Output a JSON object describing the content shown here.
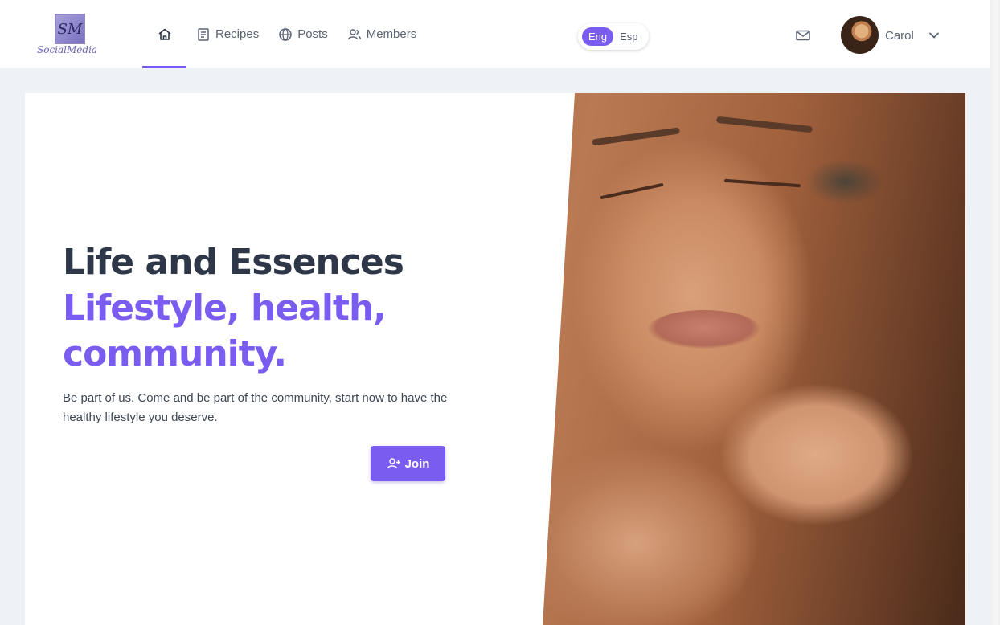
{
  "brand": {
    "logo_monogram": "SM",
    "wordmark": "SocialMedia"
  },
  "nav": {
    "items": [
      {
        "name": "home",
        "label": "",
        "icon": "home-icon",
        "active": true
      },
      {
        "name": "recipes",
        "label": "Recipes",
        "icon": "book-icon"
      },
      {
        "name": "posts",
        "label": "Posts",
        "icon": "globe-icon"
      },
      {
        "name": "members",
        "label": "Members",
        "icon": "users-icon"
      }
    ]
  },
  "language": {
    "options": [
      "Eng",
      "Esp"
    ],
    "selected": "Eng"
  },
  "user": {
    "name": "Carol",
    "mail_icon": "mail-icon",
    "menu_icon": "chevron-down-icon"
  },
  "hero": {
    "title": "Life and Essences",
    "highlight_line1": "Lifestyle, health,",
    "highlight_line2": "community.",
    "description": "Be part of us. Come and be part of the community, start now to have the healthy lifestyle you deserve.",
    "cta_label": "Join",
    "cta_icon": "user-plus-icon"
  },
  "colors": {
    "accent": "#7a5cf0",
    "text_dark": "#2d3748",
    "page_bg": "#eef1f6"
  }
}
